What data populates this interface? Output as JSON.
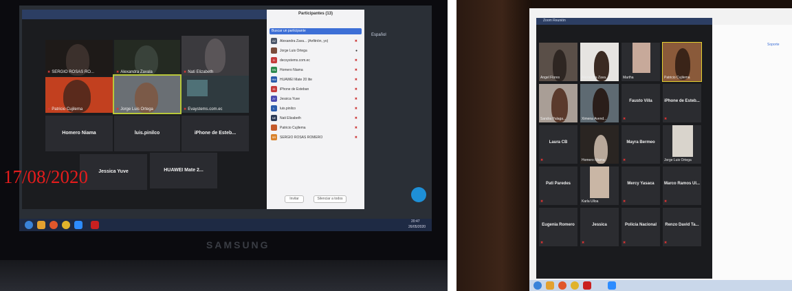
{
  "date_stamp": "17/08/2020",
  "laptop_brand": "SAMSUNG",
  "left_meeting": {
    "tiles": [
      "SERGIO ROSAS RO...",
      "Alexandra Zavala",
      "Nati Elizabeth",
      "Patricio Cujilema",
      "Jorge Luis Ortega",
      "Evaystems.com.ec",
      "Homero Niama",
      "luis.pinilco",
      "iPhone de Esteb...",
      "Jessica Yuve",
      "HUAWEI Mate 2..."
    ],
    "participants_title": "Participantes (13)",
    "search_placeholder": "Buscar un participante",
    "participants": [
      "Alexandra Zava... (Anfitrión, yo)",
      "Jorge Luis Ortega",
      "decsystems.com.ec",
      "Homero Niama",
      "HUAWEI Mate 20 lite",
      "iPhone de Esteban",
      "Jessica Yuve",
      "luis.pinilco",
      "Nati Elizabeth",
      "Patricio Cujilema",
      "SERGIO ROSAS ROMERO"
    ],
    "invite_label": "Invitar",
    "mute_all_label": "Silenciar a todos",
    "language_label": "Español",
    "clock": "20:47",
    "clock_date": "26/05/2020"
  },
  "right_meeting": {
    "window_title": "Zoom Reunión",
    "tiles": [
      "Angel Flores",
      "Alexandra Zava...",
      "Martha",
      "Patricio Cujilema",
      "Sandra Palaga...",
      "Ximena Avend...",
      "Fausto Villa",
      "iPhone de Esteb...",
      "Laura CB",
      "Homero Niama",
      "Mayra Bermeo",
      "Jorge Luis Ortega",
      "Pati Paredes",
      "Karla Ulloa",
      "Mercy Yasaca",
      "Marco Ramos Ul...",
      "Eugenia Romero",
      "Jessica",
      "Policía Nacional",
      "Renzo David Ta..."
    ],
    "support_label": "Soporte"
  }
}
